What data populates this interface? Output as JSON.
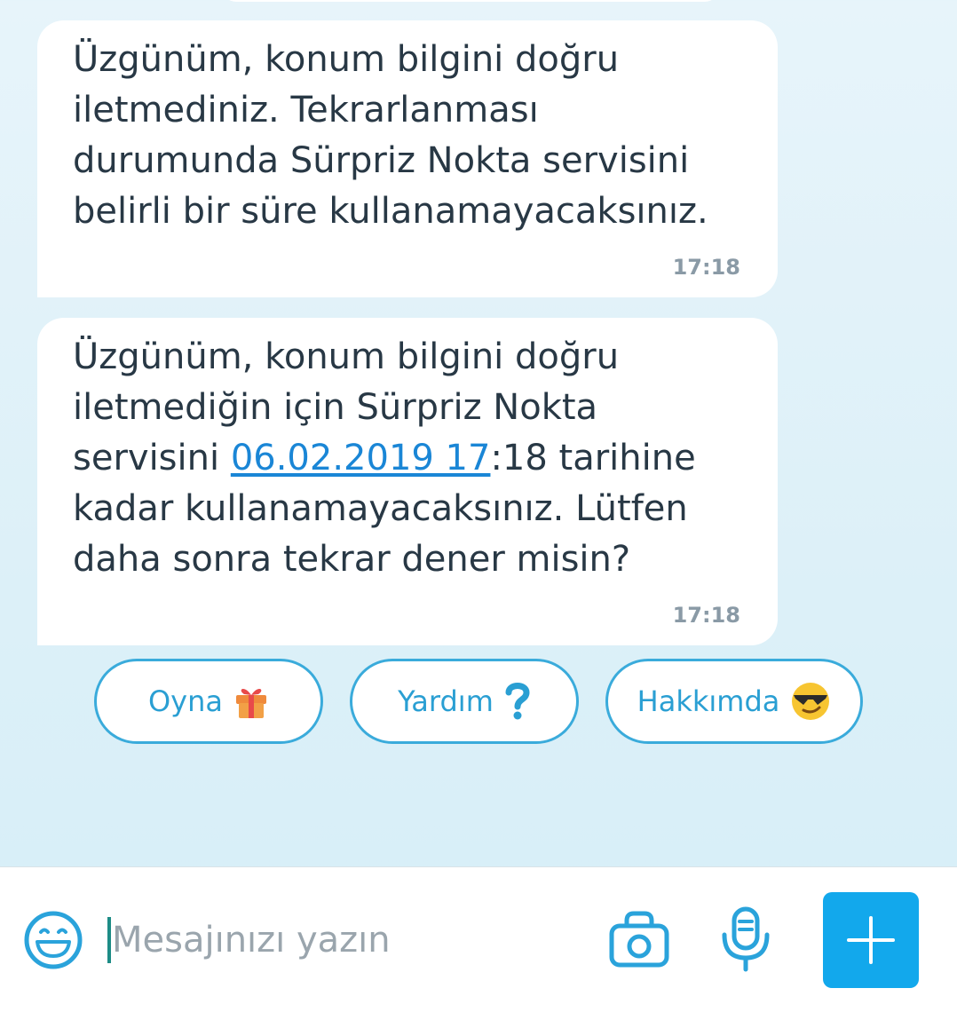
{
  "messages": [
    {
      "text": "Üzgünüm, konum bilgini doğru iletmediniz. Tekrarlanması durumunda Sürpriz Nokta servisini belirli bir süre kullanamayacaksınız.",
      "time": "17:18"
    },
    {
      "text_before": "Üzgünüm, konum bilgini doğru iletmediğin için Sürpriz Nokta servisini ",
      "link_text": "06.02.2019 17",
      "text_after": ":18 tarihine kadar kullanamayacaksınız. Lütfen daha sonra tekrar dener misin?",
      "time": "17:18"
    }
  ],
  "quick_replies": [
    {
      "label": "Oyna",
      "icon": "gift-icon"
    },
    {
      "label": "Yardım",
      "icon": "question-mark-icon"
    },
    {
      "label": "Hakkımda",
      "icon": "sunglasses-emoji-icon"
    }
  ],
  "composer": {
    "placeholder": "Mesajınızı yazın",
    "value": "",
    "icons": [
      "emoji-icon",
      "camera-icon",
      "microphone-icon",
      "plus-icon"
    ]
  },
  "colors": {
    "accent": "#12a8ec",
    "quick_reply_border": "#3aabdb",
    "link": "#1a86d6",
    "text": "#283845",
    "timestamp": "#8a9aa6"
  }
}
